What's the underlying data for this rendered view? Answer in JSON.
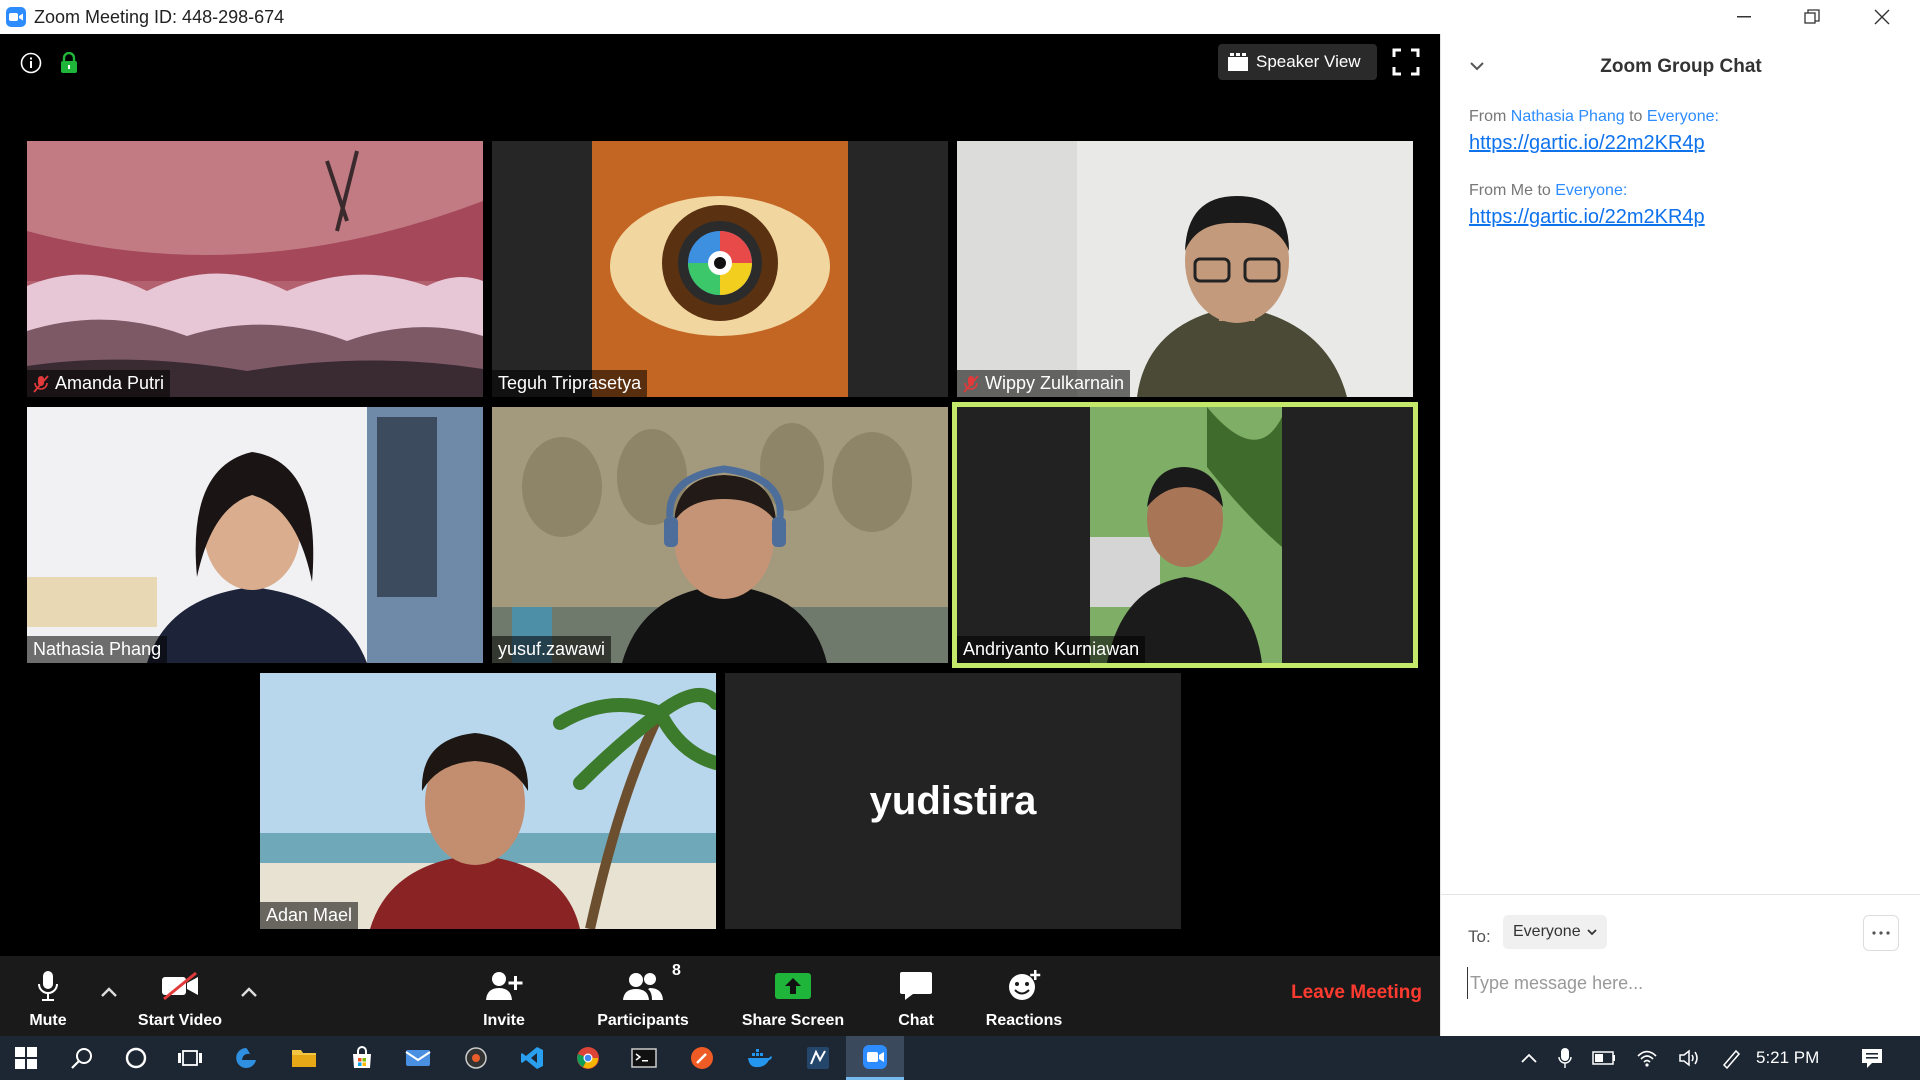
{
  "window": {
    "title": "Zoom Meeting ID: 448-298-674"
  },
  "header": {
    "view_label": "Speaker View"
  },
  "participants": [
    {
      "name": "Amanda Putri",
      "muted": true
    },
    {
      "name": "Teguh Triprasetya",
      "muted": false
    },
    {
      "name": "Wippy Zulkarnain",
      "muted": true
    },
    {
      "name": "Nathasia Phang",
      "muted": false
    },
    {
      "name": "yusuf.zawawi",
      "muted": false
    },
    {
      "name": "Andriyanto Kurniawan",
      "muted": false,
      "active_speaker": true
    },
    {
      "name": "Adan Mael",
      "muted": false
    },
    {
      "name": "yudistira",
      "video_off": true
    }
  ],
  "toolbar": {
    "mute": "Mute",
    "start_video": "Start Video",
    "invite": "Invite",
    "participants": "Participants",
    "participant_count": "8",
    "share_screen": "Share Screen",
    "chat": "Chat",
    "reactions": "Reactions",
    "leave": "Leave Meeting"
  },
  "chat": {
    "title": "Zoom Group Chat",
    "messages": [
      {
        "from_prefix": "From",
        "sender": "Nathasia Phang",
        "to_word": "to",
        "recipient": "Everyone:",
        "text": "https://gartic.io/22m2KR4p"
      },
      {
        "from_prefix": "From Me to",
        "recipient": "Everyone:",
        "text": "https://gartic.io/22m2KR4p"
      }
    ],
    "to_label": "To:",
    "to_value": "Everyone",
    "placeholder": "Type message here..."
  },
  "taskbar": {
    "time": "5:21 PM"
  },
  "colors": {
    "accent": "#2d8cff",
    "leave": "#ff3b30",
    "active_speaker": "#c3e86a",
    "share": "#1fb53b"
  }
}
